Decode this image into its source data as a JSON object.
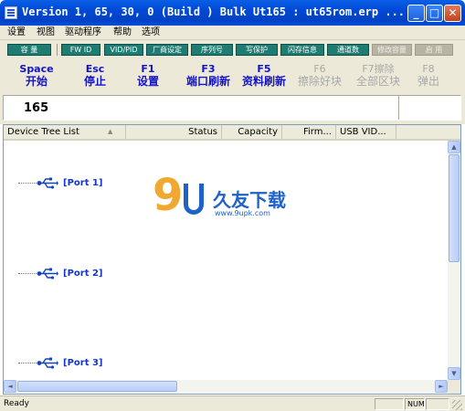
{
  "window": {
    "title": "Version 1, 65, 30, 0 (Build )  Bulk Ut165 : ut65rom.erp ...",
    "minimize_glyph": "_",
    "maximize_glyph": "□",
    "close_glyph": "✕"
  },
  "menu": [
    "设置",
    "视图",
    "驱动程序",
    "帮助",
    "选项"
  ],
  "toolbar": {
    "buttons": [
      {
        "label": "容 量",
        "enabled": true
      },
      {
        "label": "FW ID",
        "enabled": true
      },
      {
        "label": "VID/PID",
        "enabled": true
      },
      {
        "label": "厂商设定",
        "enabled": true
      },
      {
        "label": "序列号",
        "enabled": true
      },
      {
        "label": "写保护",
        "enabled": true
      },
      {
        "label": "闪存信息",
        "enabled": true
      },
      {
        "label": "通道数",
        "enabled": true
      },
      {
        "label": "修改容量",
        "enabled": false
      },
      {
        "label": "启 用",
        "enabled": false
      }
    ]
  },
  "function_keys": [
    {
      "key": "Space",
      "label": "开始",
      "enabled": true
    },
    {
      "key": "Esc",
      "label": "停止",
      "enabled": true
    },
    {
      "key": "F1",
      "label": "设置",
      "enabled": true
    },
    {
      "key": "F3",
      "label": "端口刷新",
      "enabled": true
    },
    {
      "key": "F5",
      "label": "资料刷新",
      "enabled": true
    },
    {
      "key": "F6",
      "label": "擦除好块",
      "enabled": false
    },
    {
      "key": "F7擦除",
      "label": "全部区块",
      "enabled": false
    },
    {
      "key": "F8",
      "label": "弹出",
      "enabled": false
    }
  ],
  "count": {
    "value": "165"
  },
  "device_list": {
    "columns": [
      "Device Tree List",
      "Status",
      "Capacity",
      "Firm...",
      "USB VID..."
    ],
    "sort_indicator": "▲",
    "ports": [
      "[Port 1]",
      "[Port 2]",
      "[Port 3]"
    ]
  },
  "watermark": {
    "digit": "9",
    "brand": "久友下载",
    "url": "www.9upk.com"
  },
  "scroll": {
    "up": "▲",
    "down": "▼",
    "left": "◄",
    "right": "►"
  },
  "status": {
    "text": "Ready",
    "num_indicator": "NUM"
  }
}
